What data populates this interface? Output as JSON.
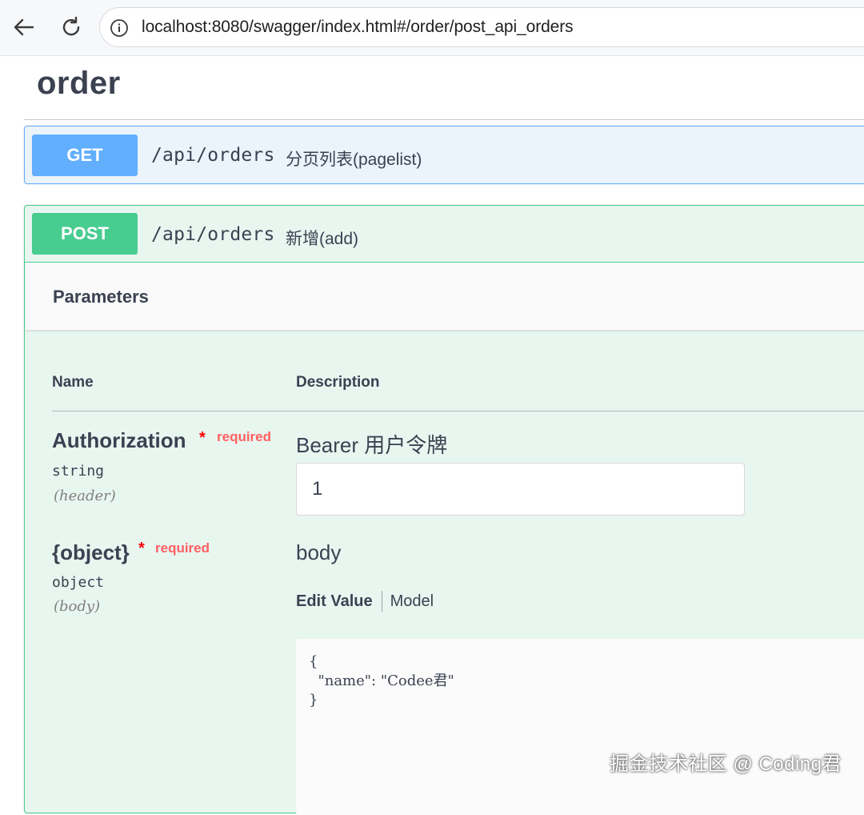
{
  "browser": {
    "url": "localhost:8080/swagger/index.html#/order/post_api_orders"
  },
  "tag": {
    "title": "order"
  },
  "operations": [
    {
      "method": "GET",
      "path": "/api/orders",
      "summary": "分页列表(pagelist)"
    },
    {
      "method": "POST",
      "path": "/api/orders",
      "summary": "新增(add)"
    }
  ],
  "parameters": {
    "title": "Parameters",
    "columns": {
      "name": "Name",
      "description": "Description"
    },
    "items": [
      {
        "name": "Authorization",
        "star": "*",
        "required": "required",
        "type": "string",
        "in": "(header)",
        "description": "Bearer 用户令牌",
        "value": "1"
      },
      {
        "name": "{object}",
        "star": "*",
        "required": "required",
        "type": "object",
        "in": "(body)",
        "description": "body",
        "tabs": {
          "edit": "Edit Value",
          "model": "Model"
        },
        "body_text": "{\n  \"name\": \"Codee君\"\n}"
      }
    ]
  },
  "watermark": "掘金技术社区 @ Coding君"
}
